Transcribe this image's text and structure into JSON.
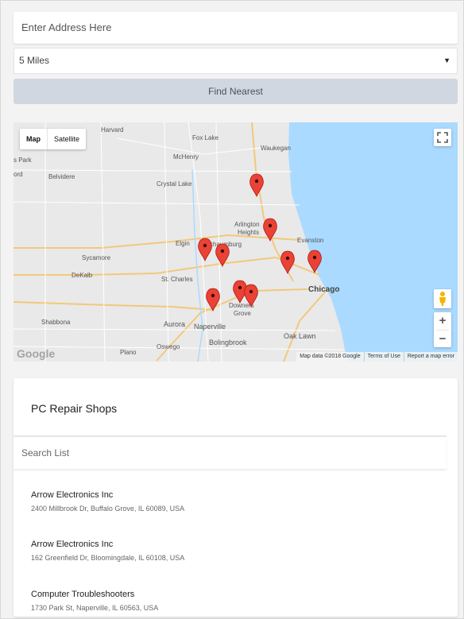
{
  "search": {
    "address_placeholder": "Enter Address Here",
    "radius_value": "5 Miles",
    "find_label": "Find Nearest"
  },
  "map": {
    "type_map": "Map",
    "type_satellite": "Satellite",
    "zoom_in": "+",
    "zoom_out": "−",
    "google_logo": "Google",
    "attribution": {
      "data": "Map data ©2018 Google",
      "terms": "Terms of Use",
      "report": "Report a map error"
    },
    "places": [
      "Harvard",
      "Fox Lake",
      "Waukegan",
      "s Park",
      "McHenry",
      "ord",
      "Belvidere",
      "Crystal Lake",
      "Arlington",
      "Heights",
      "Evanston",
      "Elgin",
      "chaumburg",
      "Sycamore",
      "DeKalb",
      "St. Charles",
      "Chicago",
      "Downers",
      "Grove",
      "Shabbona",
      "Aurora",
      "Naperville",
      "Oak Lawn",
      "Bolingbrook",
      "Plano",
      "Oswego"
    ],
    "colors": {
      "water": "#aadaff",
      "land": "#e9e9e9",
      "marker": "#ea4335"
    }
  },
  "list": {
    "title": "PC Repair Shops",
    "search_placeholder": "Search List",
    "shops": [
      {
        "name": "Arrow Electronics Inc",
        "address": "2400 Millbrook Dr, Buffalo Grove, IL 60089, USA"
      },
      {
        "name": "Arrow Electronics Inc",
        "address": "162 Greenfield Dr, Bloomingdale, IL 60108, USA"
      },
      {
        "name": "Computer Troubleshooters",
        "address": "1730 Park St, Naperville, IL 60563, USA"
      }
    ]
  }
}
